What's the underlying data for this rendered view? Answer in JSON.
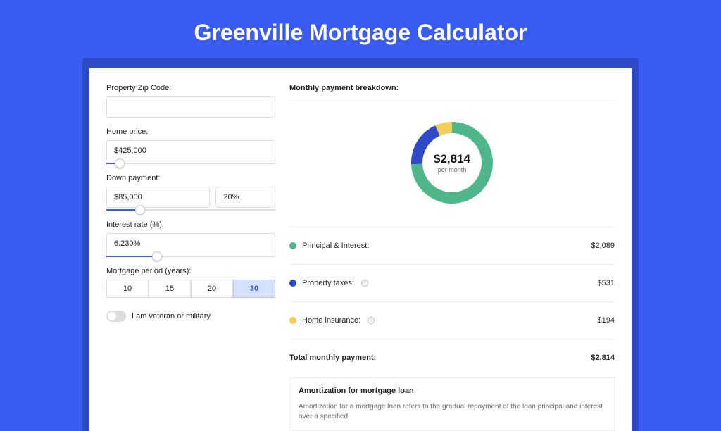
{
  "title": "Greenville Mortgage Calculator",
  "inputs": {
    "zip_label": "Property Zip Code:",
    "zip_value": "",
    "home_price_label": "Home price:",
    "home_price_value": "$425,000",
    "home_price_slider_pct": 8,
    "down_payment_label": "Down payment:",
    "down_payment_value": "$85,000",
    "down_payment_pct_value": "20%",
    "down_payment_slider_pct": 20,
    "interest_label": "Interest rate (%):",
    "interest_value": "6.230%",
    "interest_slider_pct": 30,
    "period_label": "Mortgage period (years):",
    "periods": [
      "10",
      "15",
      "20",
      "30"
    ],
    "period_active": "30",
    "veteran_label": "I am veteran or military"
  },
  "breakdown": {
    "title": "Monthly payment breakdown:",
    "donut_value": "$2,814",
    "donut_sub": "per month",
    "items": [
      {
        "label": "Principal & Interest:",
        "value": "$2,089",
        "color": "#4fb68a",
        "info": false
      },
      {
        "label": "Property taxes:",
        "value": "$531",
        "color": "#2e4ac7",
        "info": true
      },
      {
        "label": "Home insurance:",
        "value": "$194",
        "color": "#f2cf5b",
        "info": true
      }
    ],
    "total_label": "Total monthly payment:",
    "total_value": "$2,814"
  },
  "chart_data": {
    "type": "pie",
    "title": "Monthly payment breakdown",
    "series": [
      {
        "name": "Principal & Interest",
        "value": 2089,
        "color": "#4fb68a"
      },
      {
        "name": "Property taxes",
        "value": 531,
        "color": "#2e4ac7"
      },
      {
        "name": "Home insurance",
        "value": 194,
        "color": "#f2cf5b"
      }
    ],
    "total": 2814,
    "center_label": "$2,814",
    "center_sublabel": "per month"
  },
  "amort": {
    "title": "Amortization for mortgage loan",
    "body": "Amortization for a mortgage loan refers to the gradual repayment of the loan principal and interest over a specified"
  }
}
